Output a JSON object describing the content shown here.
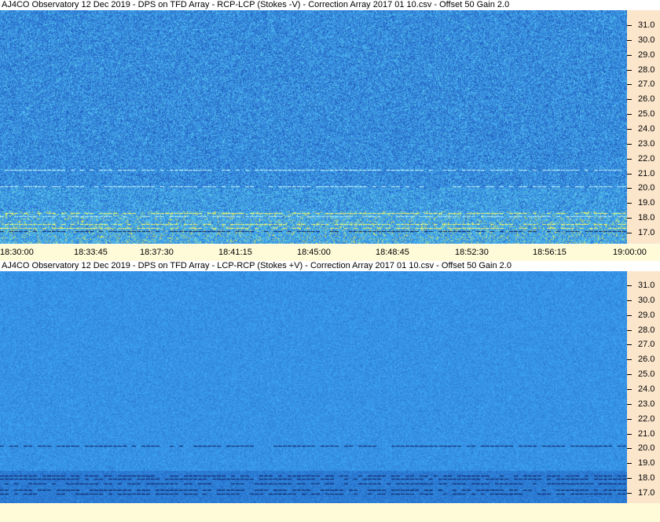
{
  "panels": [
    {
      "title": "AJ4CO Observatory 12 Dec 2019  -  DPS on TFD Array  -  RCP-LCP (Stokes -V)  -  Correction Array 2017 01 10.csv  -  Offset 50  Gain 2.0",
      "y_ticks": [
        "31.0",
        "30.0",
        "29.0",
        "28.0",
        "27.0",
        "26.0",
        "25.0",
        "24.0",
        "23.0",
        "22.0",
        "21.0",
        "20.0",
        "19.0",
        "18.0",
        "17.0"
      ]
    },
    {
      "title": "AJ4CO Observatory 12 Dec 2019  -  DPS on TFD Array  -  LCP-RCP (Stokes +V)  -  Correction Array 2017 01 10.csv  -  Offset 50  Gain 2.0",
      "y_ticks": [
        "31.0",
        "30.0",
        "29.0",
        "28.0",
        "27.0",
        "26.0",
        "25.0",
        "24.0",
        "23.0",
        "22.0",
        "21.0",
        "20.0",
        "19.0",
        "18.0",
        "17.0"
      ]
    }
  ],
  "x_ticks": [
    "18:30:00",
    "18:33:45",
    "18:37:30",
    "18:41:15",
    "18:45:00",
    "18:48:45",
    "18:52:30",
    "18:56:15",
    "19:00:00"
  ],
  "colors": {
    "spectrogram_base": "#2a62d6",
    "axis_bg": "#fbe6cc",
    "strip_bg": "#fffbd8"
  }
}
